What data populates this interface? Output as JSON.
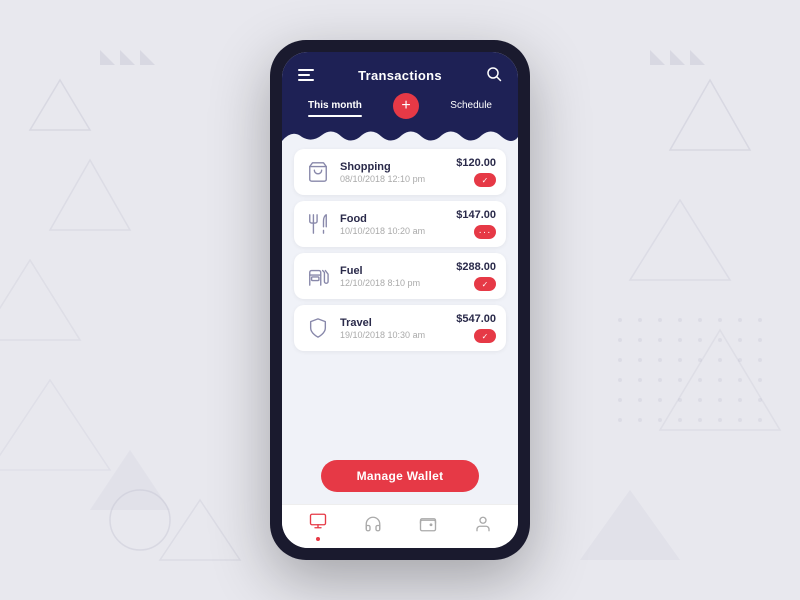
{
  "app": {
    "title": "Transactions"
  },
  "header": {
    "title": "Transactions",
    "menu_icon": "☰",
    "search_icon": "🔍"
  },
  "tabs": [
    {
      "label": "This month",
      "active": true
    },
    {
      "label": "Schedule",
      "active": false
    }
  ],
  "add_button_label": "+",
  "transactions": [
    {
      "id": 1,
      "name": "Shopping",
      "date": "08/10/2018  12:10 pm",
      "amount": "$120.00",
      "status": "done",
      "icon": "shopping"
    },
    {
      "id": 2,
      "name": "Food",
      "date": "10/10/2018  10:20 am",
      "amount": "$147.00",
      "status": "pending",
      "icon": "food"
    },
    {
      "id": 3,
      "name": "Fuel",
      "date": "12/10/2018  8:10 pm",
      "amount": "$288.00",
      "status": "done",
      "icon": "fuel"
    },
    {
      "id": 4,
      "name": "Travel",
      "date": "19/10/2018  10:30 am",
      "amount": "$547.00",
      "status": "done",
      "icon": "travel"
    }
  ],
  "manage_wallet": {
    "label": "Manage Wallet"
  },
  "bottom_nav": [
    {
      "icon": "transactions",
      "active": true
    },
    {
      "icon": "headphone",
      "active": false
    },
    {
      "icon": "wallet",
      "active": false
    },
    {
      "icon": "profile",
      "active": false
    }
  ],
  "colors": {
    "header_bg": "#1e2155",
    "accent": "#e63946",
    "screen_bg": "#f0f2f8",
    "card_bg": "#ffffff"
  }
}
